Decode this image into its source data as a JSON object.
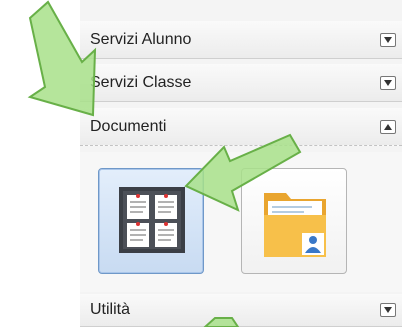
{
  "accordion": {
    "items": [
      {
        "label": "Servizi Alunno",
        "state": "collapsed"
      },
      {
        "label": "Servizi Classe",
        "state": "collapsed"
      },
      {
        "label": "Documenti",
        "state": "expanded"
      },
      {
        "label": "Utilità",
        "state": "collapsed"
      }
    ]
  },
  "documenti": {
    "buttons": [
      {
        "icon": "bulletin-board-icon",
        "selected": true
      },
      {
        "icon": "user-folder-icon",
        "selected": false
      }
    ]
  },
  "colors": {
    "arrow_fill": "#a8e08a",
    "arrow_stroke": "#68b048",
    "selected_bg": "#c8dbf2",
    "folder": "#f7c04a"
  }
}
